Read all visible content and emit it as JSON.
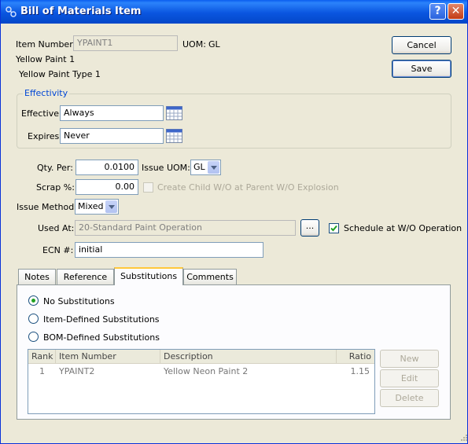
{
  "window": {
    "title": "Bill of Materials Item",
    "help_glyph": "?",
    "close_glyph": "✕"
  },
  "header": {
    "item_number_label": "Item Number:",
    "item_number_value": "YPAINT1",
    "uom_label": "UOM:",
    "uom_value": "GL",
    "description1": "Yellow Paint 1",
    "description2": "Yellow Paint Type 1"
  },
  "buttons": {
    "cancel": "Cancel",
    "save": "Save",
    "ellipsis": "...",
    "new": "New",
    "edit": "Edit",
    "delete": "Delete"
  },
  "effectivity": {
    "title": "Effectivity",
    "effective_label": "Effective",
    "effective_value": "Always",
    "expires_label": "Expires",
    "expires_value": "Never"
  },
  "form": {
    "qty_per_label": "Qty. Per:",
    "qty_per_value": "0.0100",
    "issue_uom_label": "Issue UOM:",
    "issue_uom_value": "GL",
    "scrap_label": "Scrap %:",
    "scrap_value": "0.00",
    "create_child_label": "Create Child W/O at Parent W/O Explosion",
    "create_child_checked": false,
    "issue_method_label": "Issue Method:",
    "issue_method_value": "Mixed",
    "used_at_label": "Used At:",
    "used_at_value": "20-Standard Paint Operation",
    "schedule_label": "Schedule at W/O Operation",
    "schedule_checked": true,
    "ecn_label": "ECN #:",
    "ecn_value": "initial"
  },
  "tabs": [
    {
      "label": "Notes",
      "active": false
    },
    {
      "label": "Reference",
      "active": false
    },
    {
      "label": "Substitutions",
      "active": true
    },
    {
      "label": "Comments",
      "active": false
    }
  ],
  "substitutions": {
    "options": [
      {
        "label": "No Substitutions",
        "selected": true
      },
      {
        "label": "Item-Defined Substitutions",
        "selected": false
      },
      {
        "label": "BOM-Defined Substitutions",
        "selected": false
      }
    ],
    "columns": [
      "Rank",
      "Item Number",
      "Description",
      "Ratio"
    ],
    "rows": [
      {
        "rank": "1",
        "item_number": "YPAINT2",
        "description": "Yellow Neon Paint 2",
        "ratio": "1.15"
      }
    ]
  },
  "colors": {
    "title_bar": "#0a55e0",
    "dialog_bg": "#ece9d8",
    "group_title": "#0046d5",
    "checkbox_mark": "#21a121"
  }
}
